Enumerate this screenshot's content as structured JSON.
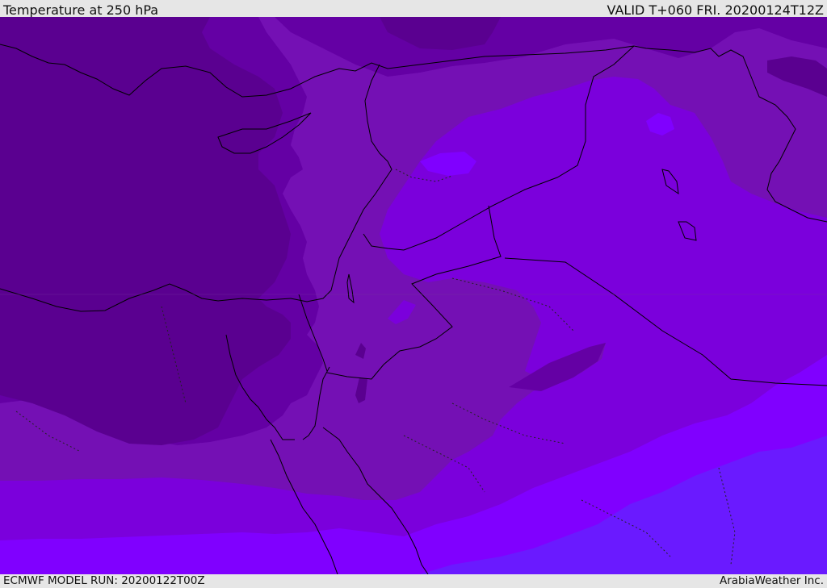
{
  "header": {
    "title": "Temperature at 250 hPa",
    "valid": "VALID T+060 FRI. 20200124T12Z"
  },
  "footer": {
    "model_run": "ECMWF MODEL RUN: 20200122T00Z",
    "credit": "ArabiaWeather Inc."
  },
  "map": {
    "palette": {
      "coldest": "#5a0090",
      "cold": "#6400a4",
      "mid": "#7410b4",
      "warm": "#7b00dc",
      "warmer": "#8000ff",
      "warmest": "#6a1aff"
    },
    "border_color": "#000000"
  }
}
